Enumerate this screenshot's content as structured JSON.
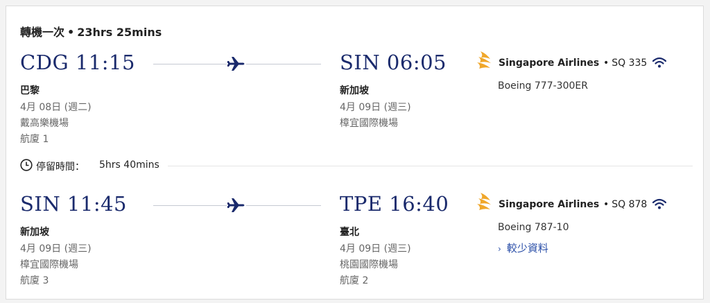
{
  "summary": {
    "stops": "轉機一次",
    "separator": "•",
    "total_duration": "23hrs 25mins"
  },
  "segments": [
    {
      "departure": {
        "code_time": "CDG 11:15",
        "city": "巴黎",
        "date": "4月 08日 (週二)",
        "airport": "戴高樂機場",
        "terminal": "航廈 1"
      },
      "arrival": {
        "code_time": "SIN 06:05",
        "city": "新加坡",
        "date": "4月 09日 (週三)",
        "airport": "樟宜國際機場",
        "terminal": ""
      },
      "airline": {
        "name": "Singapore Airlines",
        "separator": "•",
        "flight_number": "SQ 335",
        "aircraft": "Boeing 777-300ER",
        "wifi_icon": "wifi-icon"
      }
    },
    {
      "departure": {
        "code_time": "SIN 11:45",
        "city": "新加坡",
        "date": "4月 09日 (週三)",
        "airport": "樟宜國際機場",
        "terminal": "航廈 3"
      },
      "arrival": {
        "code_time": "TPE 16:40",
        "city": "臺北",
        "date": "4月 09日 (週三)",
        "airport": "桃園國際機場",
        "terminal": "航廈 2"
      },
      "airline": {
        "name": "Singapore Airlines",
        "separator": "•",
        "flight_number": "SQ 878",
        "aircraft": "Boeing 787-10",
        "wifi_icon": "wifi-icon",
        "more_link": "較少資料",
        "more_chevron": "›"
      }
    }
  ],
  "layover": {
    "label": "停留時間：",
    "duration": "5hrs 40mins"
  },
  "colors": {
    "brand_navy": "#1a2a6c",
    "logo_gold": "#f0a72a",
    "link_blue": "#2b4fa8",
    "muted_text": "#666666"
  }
}
